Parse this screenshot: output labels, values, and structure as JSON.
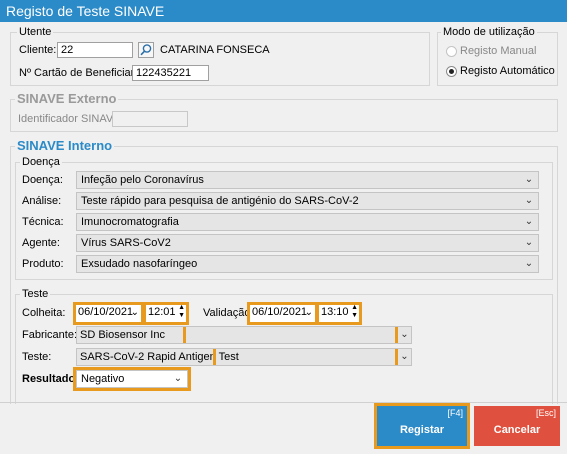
{
  "window": {
    "title": "Registo de Teste SINAVE"
  },
  "utente": {
    "legend": "Utente",
    "cliente_label": "Cliente:",
    "cliente_value": "22",
    "cliente_name": "CATARINA FONSECA",
    "cartao_label": "Nº Cartão de Beneficiario:",
    "cartao_value": "122435221"
  },
  "modo": {
    "legend": "Modo de utilização",
    "manual_label": "Registo Manual",
    "auto_label": "Registo Automático",
    "selected": "Registo Automático"
  },
  "externo": {
    "legend": "SINAVE Externo",
    "identificador_label": "Identificador SINAVE:",
    "identificador_value": ""
  },
  "interno": {
    "legend": "SINAVE Interno",
    "doenca_group": "Doença",
    "doenca_label": "Doença:",
    "doenca_value": "Infeção pelo Coronavírus",
    "analise_label": "Análise:",
    "analise_value": "Teste rápido para pesquisa de antigénio do SARS-CoV-2",
    "tecnica_label": "Técnica:",
    "tecnica_value": "Imunocromatografia",
    "agente_label": "Agente:",
    "agente_value": "Vírus SARS-CoV2",
    "produto_label": "Produto:",
    "produto_value": "Exsudado nasofaríngeo"
  },
  "teste": {
    "legend": "Teste",
    "colheita_label": "Colheita:",
    "colheita_date": "06/10/2021",
    "colheita_time": "12:01",
    "validacao_label": "Validação:",
    "validacao_date": "06/10/2021",
    "validacao_time": "13:10",
    "fabricante_label": "Fabricante:",
    "fabricante_value": "SD Biosensor Inc",
    "teste_label": "Teste:",
    "teste_value": "SARS-CoV-2 Rapid Antigen Test",
    "resultado_label": "Resultado:",
    "resultado_value": "Negativo"
  },
  "buttons": {
    "registar_label": "Registar",
    "registar_key": "[F4]",
    "cancelar_label": "Cancelar",
    "cancelar_key": "[Esc]"
  },
  "colors": {
    "title_bar": "#2b8ac8",
    "registar": "#2b8ac8",
    "cancelar": "#e0503e",
    "highlight": "#e79a1e"
  }
}
